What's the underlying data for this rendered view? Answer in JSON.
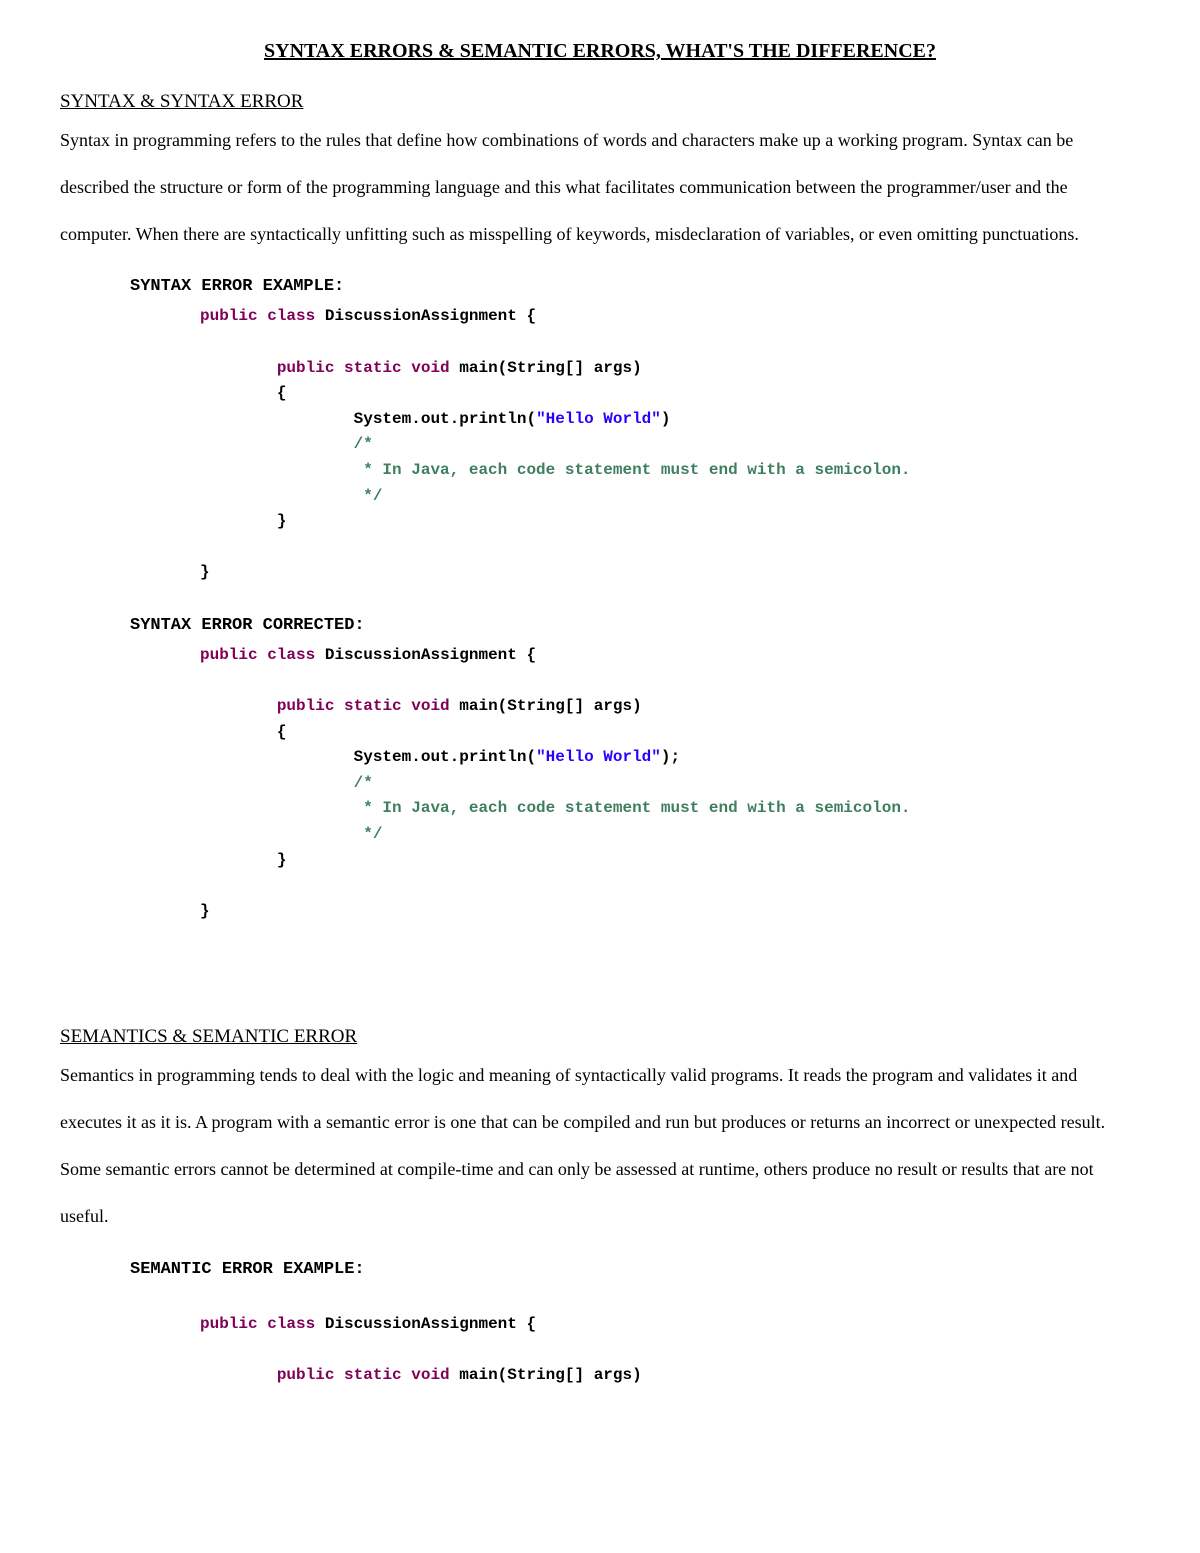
{
  "title": "SYNTAX ERRORS & SEMANTIC ERRORS, WHAT'S THE DIFFERENCE?",
  "section1": {
    "heading": "SYNTAX & SYNTAX ERROR",
    "body": "Syntax in programming refers to the rules that define how combinations of words and characters make up a working program. Syntax can be described the structure or form of the programming language and this what facilitates communication between the programmer/user and the computer. When there are syntactically unfitting such as misspelling of keywords, misdeclaration of variables, or even omitting punctuations."
  },
  "code1": {
    "heading": "SYNTAX ERROR EXAMPLE:",
    "kw_public": "public",
    "kw_class": "class",
    "cls_name": "DiscussionAssignment {",
    "kw_static": "static",
    "kw_void": "void",
    "main_sig1": "main(String[]",
    "main_sig2": "args)",
    "brace_open": "{",
    "println_part1": "System.out.println(",
    "str_hello": "\"Hello World\"",
    "println_close": ")",
    "cmt_open": "/*",
    "cmt_body": " * In Java, each code statement must end with a semicolon.",
    "cmt_close": " */",
    "brace_close": "}",
    "brace_close2": "}"
  },
  "code2": {
    "heading": "SYNTAX ERROR CORRECTED:",
    "kw_public": "public",
    "kw_class": "class",
    "cls_name": "DiscussionAssignment {",
    "kw_static": "static",
    "kw_void": "void",
    "main_sig1": "main(String[]",
    "main_sig2": "args)",
    "brace_open": "{",
    "println_part1": "System.out.println(",
    "str_hello": "\"Hello World\"",
    "println_close": ");",
    "cmt_open": "/*",
    "cmt_body": " * In Java, each code statement must end with a semicolon.",
    "cmt_close": " */",
    "brace_close": "}",
    "brace_close2": "}"
  },
  "section2": {
    "heading": "SEMANTICS & SEMANTIC ERROR",
    "body": "Semantics in programming tends to deal with the logic and meaning of syntactically valid programs. It reads the program and validates it and executes it as it is. A program with a semantic error is one that can be compiled and run but produces or returns an incorrect or unexpected result. Some semantic errors cannot be determined at compile-time and can only be assessed at runtime, others produce no result or results that are not useful."
  },
  "code3": {
    "heading": "SEMANTIC ERROR EXAMPLE:",
    "kw_public": "public",
    "kw_class": "class",
    "cls_name": "DiscussionAssignment {",
    "kw_static": "static",
    "kw_void": "void",
    "main_sig1": "main(String[]",
    "main_sig2": "args)"
  }
}
